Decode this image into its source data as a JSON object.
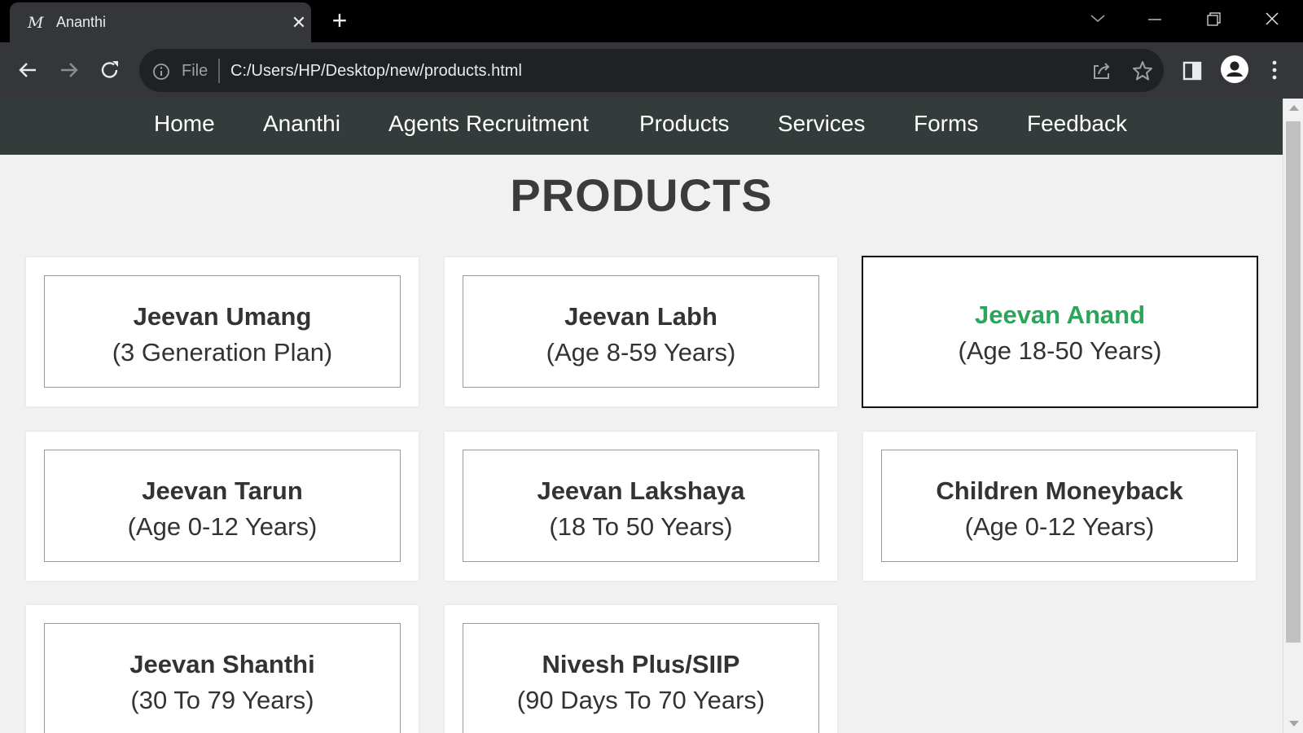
{
  "browser": {
    "tab": {
      "favicon": "M",
      "title": "Ananthi",
      "close": "✕"
    },
    "new_tab": "+",
    "omnibox": {
      "scheme_label": "File",
      "url": "C:/Users/HP/Desktop/new/products.html"
    }
  },
  "site": {
    "nav": [
      "Home",
      "Ananthi",
      "Agents Recruitment",
      "Products",
      "Services",
      "Forms",
      "Feedback"
    ],
    "page_title": "PRODUCTS",
    "accent_color": "#2aa65a",
    "nav_background": "#333b3b",
    "products": [
      {
        "name": "Jeevan Umang",
        "sub": "(3 Generation Plan)"
      },
      {
        "name": "Jeevan Labh",
        "sub": "(Age 8-59 Years)"
      },
      {
        "name": "Jeevan Anand",
        "sub": "(Age 18-50 Years)"
      },
      {
        "name": "Jeevan Tarun",
        "sub": "(Age 0-12 Years)"
      },
      {
        "name": "Jeevan Lakshaya",
        "sub": "(18 To 50 Years)"
      },
      {
        "name": "Children Moneyback",
        "sub": "(Age 0-12 Years)"
      },
      {
        "name": "Jeevan Shanthi",
        "sub": "(30 To 79 Years)"
      },
      {
        "name": "Nivesh Plus/SIIP",
        "sub": "(90 Days To 70 Years)"
      }
    ]
  }
}
